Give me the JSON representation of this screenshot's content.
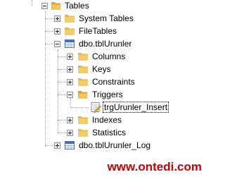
{
  "tree": {
    "tables_label": "Tables",
    "system_tables_label": "System Tables",
    "file_tables_label": "FileTables",
    "table1_label": "dbo.tblUrunler",
    "columns_label": "Columns",
    "keys_label": "Keys",
    "constraints_label": "Constraints",
    "triggers_label": "Triggers",
    "trigger_item_label": "trgUrunler_Insert",
    "indexes_label": "Indexes",
    "statistics_label": "Statistics",
    "table2_label": "dbo.tblUrunler_Log"
  },
  "watermark": "www.ontedi.com",
  "colors": {
    "folder": "#e8b64a",
    "watermark": "#cc0000",
    "table_icon": "#4a6fb5"
  }
}
